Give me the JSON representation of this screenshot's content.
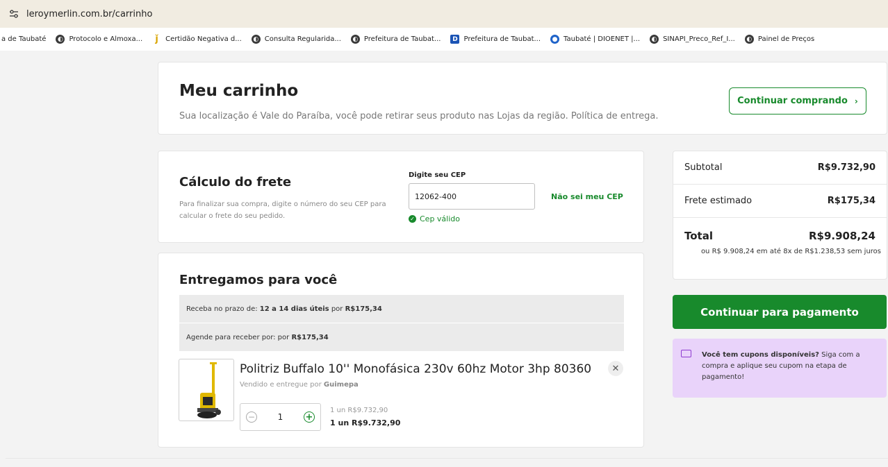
{
  "browser": {
    "url": "leroymerlin.com.br/carrinho",
    "bookmarks": [
      {
        "label": "a de Taubaté",
        "icon": "none"
      },
      {
        "label": "Protocolo e Almoxa...",
        "icon": "globe-icon"
      },
      {
        "label": "Certidão Negativa d...",
        "icon": "figure-icon"
      },
      {
        "label": "Consulta Regularida...",
        "icon": "globe-icon"
      },
      {
        "label": "Prefeitura de Taubat...",
        "icon": "globe-icon"
      },
      {
        "label": "Prefeitura de Taubat...",
        "icon": "d-icon"
      },
      {
        "label": "Taubaté | DIOENET |...",
        "icon": "blue-circle-icon"
      },
      {
        "label": "SINAPI_Preco_Ref_I...",
        "icon": "globe-icon"
      },
      {
        "label": "Painel de Preços",
        "icon": "globe-icon"
      }
    ]
  },
  "header": {
    "title": "Meu carrinho",
    "location_text": "Sua localização é Vale do Paraíba, você pode retirar seus produto nas Lojas da região. Política de entrega.",
    "continue_button": "Continuar comprando"
  },
  "frete": {
    "title": "Cálculo do frete",
    "help": "Para finalizar sua compra, digite o número do seu CEP para calcular o frete do seu pedido.",
    "cep_label": "Digite seu CEP",
    "cep_value": "12062-400",
    "cep_link": "Não sei meu CEP",
    "cep_status": "Cep válido"
  },
  "delivery": {
    "title": "Entregamos para você",
    "option1_prefix": "Receba no prazo de: ",
    "option1_days": "12 a 14 dias úteis",
    "option1_mid": " por ",
    "option1_price": "R$175,34",
    "option2_prefix": "Agende para receber por: por ",
    "option2_price": "R$175,34"
  },
  "product": {
    "name": "Politriz Buffalo 10'' Monofásica 230v 60hz Motor 3hp 80360",
    "seller_prefix": "Vendido e entregue por ",
    "seller": "Guimepa",
    "quantity": "1",
    "unit_price": "1 un R$9.732,90",
    "total_price": "1 un R$9.732,90"
  },
  "summary": {
    "subtotal_label": "Subtotal",
    "subtotal_value": "R$9.732,90",
    "frete_label": "Frete estimado",
    "frete_value": "R$175,34",
    "total_label": "Total",
    "total_value": "R$9.908,24",
    "installments": "ou R$ 9.908,24 em até 8x de R$1.238,53 sem juros"
  },
  "actions": {
    "pay_button": "Continuar para pagamento"
  },
  "coupon": {
    "bold": "Você tem cupons disponíveis?",
    "text": " Siga com a compra e aplique seu cupom na etapa de pagamento!"
  },
  "colors": {
    "brand_green": "#188a2c",
    "coupon_bg": "#e9d3fa"
  }
}
